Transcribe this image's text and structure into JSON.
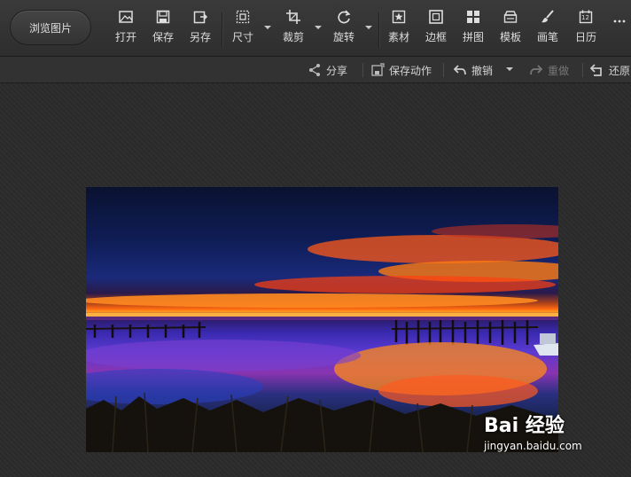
{
  "toolbar": {
    "browse_label": "浏览图片",
    "tools": [
      {
        "label": "打开",
        "icon": "open-image-icon"
      },
      {
        "label": "保存",
        "icon": "save-disk-icon"
      },
      {
        "label": "另存",
        "icon": "save-as-icon"
      },
      {
        "label": "尺寸",
        "icon": "resize-icon"
      },
      {
        "label": "裁剪",
        "icon": "crop-icon"
      },
      {
        "label": "旋转",
        "icon": "rotate-icon"
      },
      {
        "label": "素材",
        "icon": "star-material-icon"
      },
      {
        "label": "边框",
        "icon": "frame-icon"
      },
      {
        "label": "拼图",
        "icon": "puzzle-grid-icon"
      },
      {
        "label": "模板",
        "icon": "template-icon"
      },
      {
        "label": "画笔",
        "icon": "brush-icon"
      },
      {
        "label": "日历",
        "icon": "calendar-icon"
      }
    ],
    "more_icon": "more-dots-icon",
    "calendar_day": "12"
  },
  "actions": {
    "share": "分享",
    "save_action": "保存动作",
    "undo": "撤销",
    "redo": "重做",
    "restore": "还原"
  },
  "watermark": {
    "logo": "Bai 经验",
    "url": "jingyan.baidu.com"
  },
  "colors": {
    "accent": "#ff7a10",
    "toolbar_bg": "#343434",
    "workspace_bg": "#2a2a2a"
  }
}
